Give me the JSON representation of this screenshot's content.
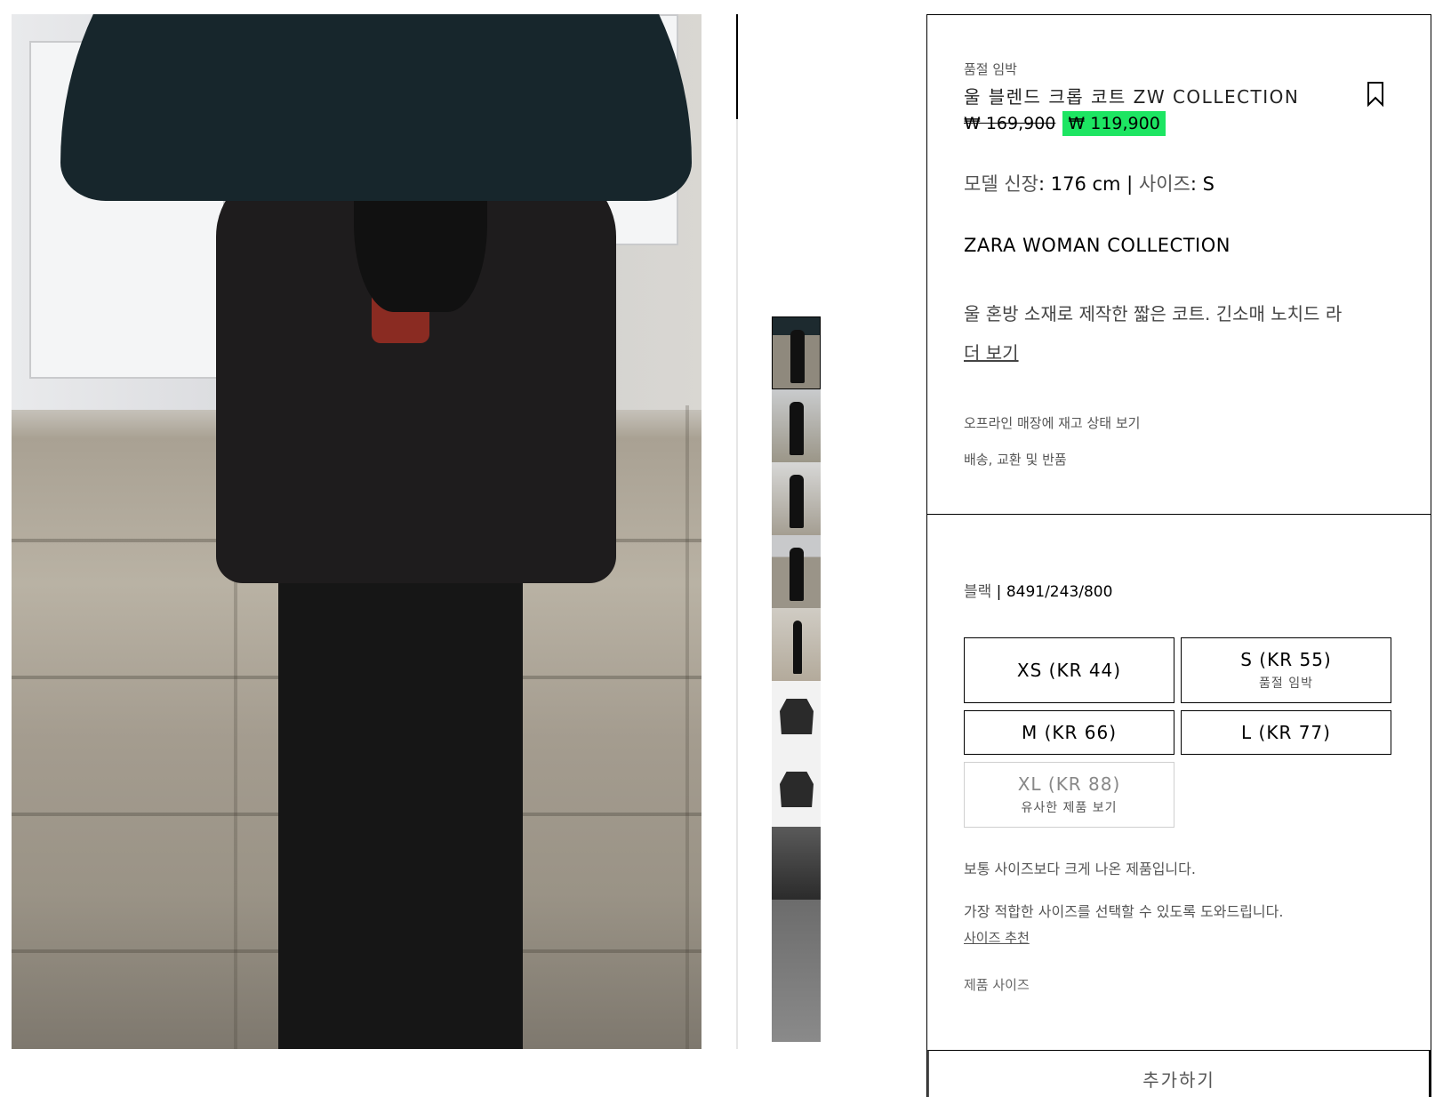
{
  "gallery": {
    "main_image_alt": "",
    "thumbnail_count": 9
  },
  "product": {
    "stock_status": "품절 임박",
    "title": "울 블렌드 크롭 코트 ZW COLLECTION",
    "old_price": "₩ 169,900",
    "new_price": "₩ 119,900",
    "sale_color": "#1de562",
    "model_height_label": "모델 신장",
    "model_height_value": ": 176 cm | ",
    "model_size_label": "사이즈",
    "model_size_value": ": S",
    "collection": "ZARA WOMAN COLLECTION",
    "description": "울 혼방 소재로 제작한 짧은 코트. 긴소매 노치드 라",
    "more_link": "더 보기",
    "store_stock_link": "오프라인 매장에 재고 상태 보기",
    "shipping_link": "배송, 교환 및 반품"
  },
  "variant": {
    "color": "블랙",
    "reference": " | 8491/243/800"
  },
  "sizes": [
    {
      "label": "XS (KR 44)",
      "sub": ""
    },
    {
      "label": "S (KR 55)",
      "sub": "품절 임박"
    },
    {
      "label": "M (KR 66)",
      "sub": ""
    },
    {
      "label": "L (KR 77)",
      "sub": ""
    },
    {
      "label": "XL (KR 88)",
      "sub": "유사한 제품 보기",
      "disabled": true
    }
  ],
  "fit": {
    "note": "보통 사이즈보다 크게 나온 제품입니다.",
    "help": "가장 적합한 사이즈를 선택할 수 있도록 도와드립니다.",
    "recommend_link": "사이즈 추천",
    "product_sizes_link": "제품 사이즈"
  },
  "actions": {
    "add_label": "추가하기"
  }
}
